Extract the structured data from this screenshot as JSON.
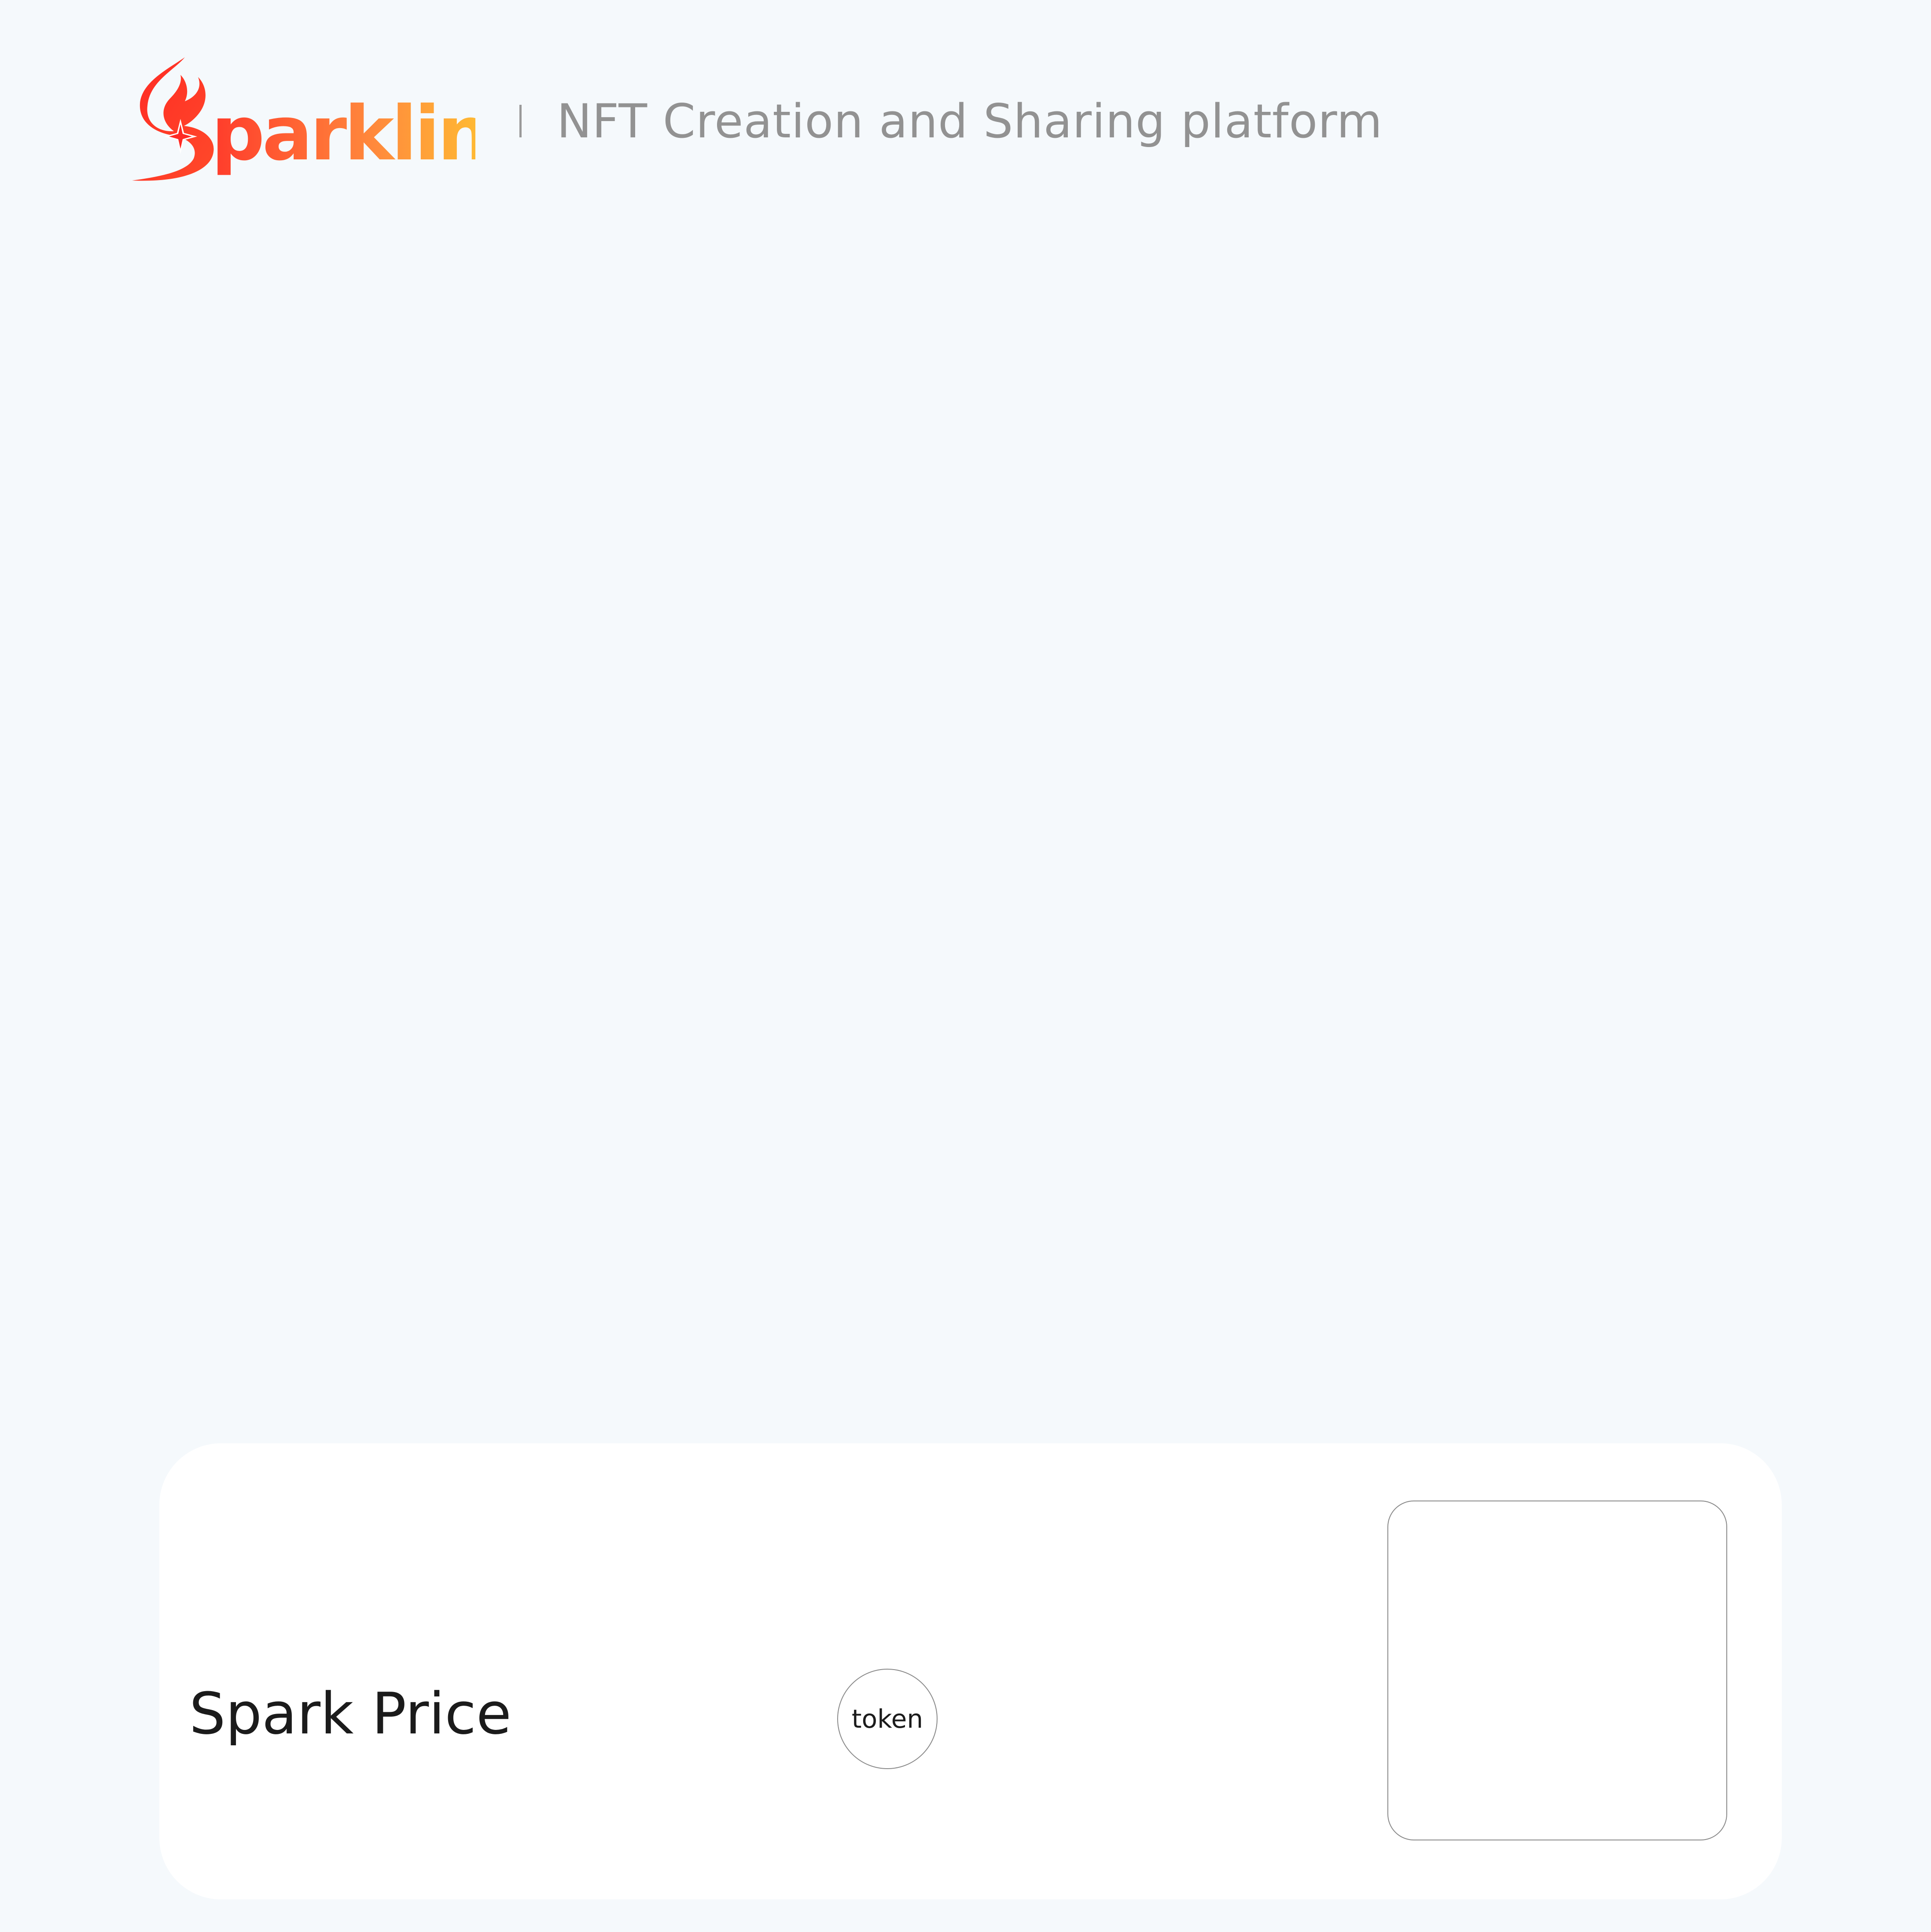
{
  "header": {
    "logo_text": "Sparklink",
    "tagline": "NFT Creation and Sharing platform"
  },
  "card": {
    "price_label": "Spark Price",
    "token_label": "token"
  },
  "colors": {
    "background": "#f5f9fc",
    "brand_red": "#ff2a24",
    "brand_yellow": "#ffd62e",
    "tagline_gray": "#929292"
  }
}
